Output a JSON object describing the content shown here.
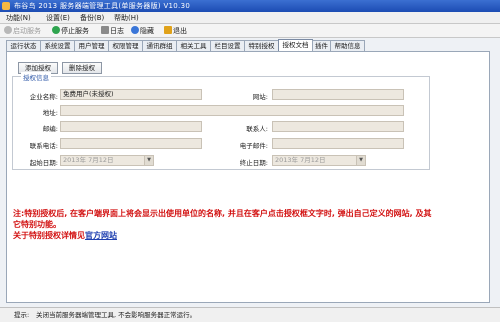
{
  "window": {
    "title": "布谷鸟 2013 服务器端管理工具(单服务器版)  V10.30"
  },
  "menu": [
    "功能(N)",
    "设置(E)",
    "备份(B)",
    "帮助(H)"
  ],
  "toolbar": {
    "start": "启动服务",
    "stop": "停止服务",
    "log": "日志",
    "hide": "隐藏",
    "exit": "退出",
    "colors": {
      "stop": "#2ea44f",
      "hide": "#3a76d8",
      "exit": "#e0a21a",
      "log": "#8a8a8a"
    }
  },
  "tabs": [
    "运行状态",
    "系统设置",
    "用户管理",
    "权限管理",
    "通讯群组",
    "相关工具",
    "栏目设置",
    "特别授权",
    "授权文档",
    "插件",
    "帮助信息"
  ],
  "active_tab": "授权文档",
  "buttons": {
    "add": "添加授权",
    "remove": "删除授权"
  },
  "group": {
    "legend": "授权信息"
  },
  "form": {
    "company_label": "企业名称:",
    "company_value": "免费用户(未授权)",
    "website_label": "网站:",
    "address_label": "地址:",
    "postcode_label": "邮编:",
    "contact_label": "联系人:",
    "phone_label": "联系电话:",
    "email_label": "电子邮件:",
    "start_label": "起始日期:",
    "start_value": "2013年 7月12日",
    "end_label": "终止日期:",
    "end_value": "2013年 7月12日"
  },
  "note": {
    "line1": "注:特别授权后, 在客户端界面上将会显示出使用单位的名称, 并且在客户点击授权框文字时, 弹出自己定义的网站, 及其它特别功能。",
    "line2_prefix": "关于特别授权详情见",
    "line2_link": "官方网站"
  },
  "status": {
    "label": "提示:",
    "text": "关闭当前服务器端管理工具, 不会影响服务器正常运行。"
  }
}
